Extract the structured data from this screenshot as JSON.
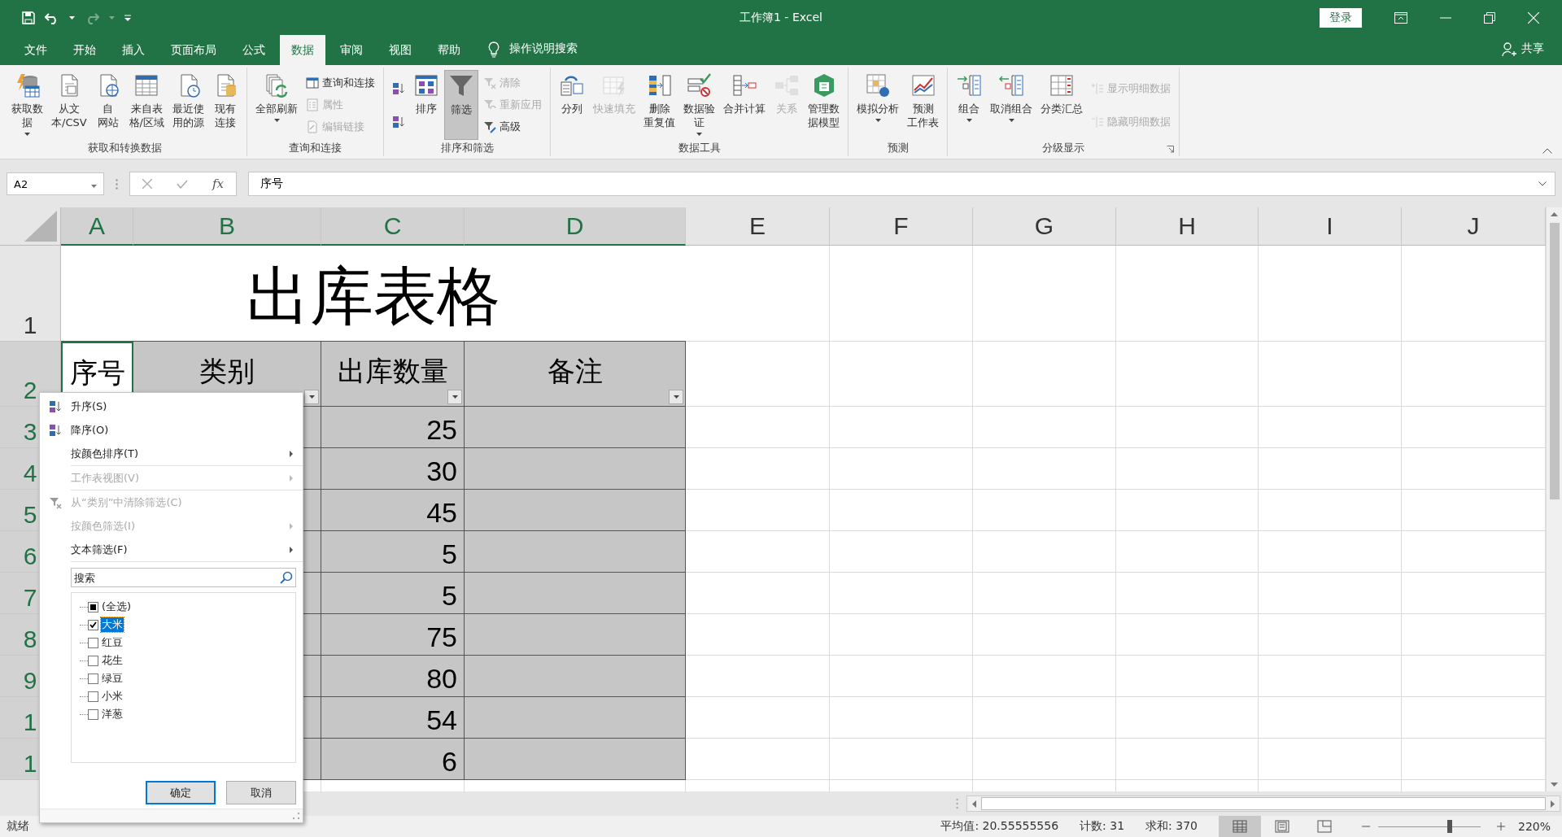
{
  "window": {
    "title": "工作簿1  -  Excel",
    "sign_in": "登录"
  },
  "quick_access": {
    "redo_enabled": false
  },
  "tabs": [
    {
      "label": "文件",
      "selected": false
    },
    {
      "label": "开始",
      "selected": false
    },
    {
      "label": "插入",
      "selected": false
    },
    {
      "label": "页面布局",
      "selected": false
    },
    {
      "label": "公式",
      "selected": false
    },
    {
      "label": "数据",
      "selected": true
    },
    {
      "label": "审阅",
      "selected": false
    },
    {
      "label": "视图",
      "selected": false
    },
    {
      "label": "帮助",
      "selected": false
    }
  ],
  "tell_me": "操作说明搜索",
  "share": "共享",
  "ribbon_groups": [
    {
      "label": "获取和转换数据",
      "launcher": false,
      "buttons": [
        {
          "lines": [
            "获取数",
            "据"
          ],
          "kind": "large",
          "disabled": false,
          "dropdown": true,
          "pressed": false
        },
        {
          "lines": [
            "从文",
            "本/CSV"
          ],
          "kind": "large",
          "disabled": false,
          "dropdown": false,
          "pressed": false
        },
        {
          "lines": [
            "自",
            "网站"
          ],
          "kind": "large",
          "disabled": false,
          "dropdown": false,
          "pressed": false
        },
        {
          "lines": [
            "来自表",
            "格/区域"
          ],
          "kind": "large",
          "disabled": false,
          "dropdown": false,
          "pressed": false
        },
        {
          "lines": [
            "最近使",
            "用的源"
          ],
          "kind": "large",
          "disabled": false,
          "dropdown": false,
          "pressed": false
        },
        {
          "lines": [
            "现有",
            "连接"
          ],
          "kind": "large",
          "disabled": false,
          "dropdown": false,
          "pressed": false
        }
      ]
    },
    {
      "label": "查询和连接",
      "launcher": false,
      "buttons": [
        {
          "lines": [
            "全部刷新"
          ],
          "kind": "large",
          "disabled": false,
          "dropdown": true,
          "pressed": false
        },
        {
          "lines": [
            "查询和连接"
          ],
          "kind": "small",
          "disabled": false,
          "dropdown": false,
          "pressed": false
        },
        {
          "lines": [
            "属性"
          ],
          "kind": "small",
          "disabled": true,
          "dropdown": false,
          "pressed": false
        },
        {
          "lines": [
            "编辑链接"
          ],
          "kind": "small",
          "disabled": true,
          "dropdown": false,
          "pressed": false
        }
      ]
    },
    {
      "label": "排序和筛选",
      "launcher": false,
      "buttons": [
        {
          "kind": "small",
          "disabled": false,
          "dropdown": false,
          "pressed": false
        },
        {
          "kind": "small",
          "disabled": false,
          "dropdown": false,
          "pressed": false
        },
        {
          "lines": [
            "排序"
          ],
          "kind": "large",
          "disabled": false,
          "dropdown": false,
          "pressed": false
        },
        {
          "lines": [
            "筛选"
          ],
          "kind": "large",
          "disabled": false,
          "dropdown": false,
          "pressed": true
        },
        {
          "lines": [
            "清除"
          ],
          "kind": "small",
          "disabled": true,
          "dropdown": false,
          "pressed": false
        },
        {
          "lines": [
            "重新应用"
          ],
          "kind": "small",
          "disabled": true,
          "dropdown": false,
          "pressed": false
        },
        {
          "lines": [
            "高级"
          ],
          "kind": "small",
          "disabled": false,
          "dropdown": false,
          "pressed": false
        }
      ]
    },
    {
      "label": "数据工具",
      "launcher": false,
      "buttons": [
        {
          "lines": [
            "分列"
          ],
          "kind": "large",
          "disabled": false,
          "dropdown": false,
          "pressed": false
        },
        {
          "lines": [
            "快速填充"
          ],
          "kind": "large",
          "disabled": true,
          "dropdown": false,
          "pressed": false
        },
        {
          "lines": [
            "删除",
            "重复值"
          ],
          "kind": "large",
          "disabled": false,
          "dropdown": false,
          "pressed": false
        },
        {
          "lines": [
            "数据验",
            "证"
          ],
          "kind": "large",
          "disabled": false,
          "dropdown": true,
          "pressed": false
        },
        {
          "lines": [
            "合并计算"
          ],
          "kind": "large",
          "disabled": false,
          "dropdown": false,
          "pressed": false
        },
        {
          "lines": [
            "关系"
          ],
          "kind": "large",
          "disabled": true,
          "dropdown": false,
          "pressed": false
        },
        {
          "lines": [
            "管理数",
            "据模型"
          ],
          "kind": "large",
          "disabled": false,
          "dropdown": false,
          "pressed": false
        }
      ]
    },
    {
      "label": "预测",
      "launcher": false,
      "buttons": [
        {
          "lines": [
            "模拟分析"
          ],
          "kind": "large",
          "disabled": false,
          "dropdown": true,
          "pressed": false
        },
        {
          "lines": [
            "预测",
            "工作表"
          ],
          "kind": "large",
          "disabled": false,
          "dropdown": false,
          "pressed": false
        }
      ]
    },
    {
      "label": "分级显示",
      "launcher": true,
      "buttons": [
        {
          "lines": [
            "组合"
          ],
          "kind": "large",
          "disabled": false,
          "dropdown": true,
          "pressed": false
        },
        {
          "lines": [
            "取消组合"
          ],
          "kind": "large",
          "disabled": false,
          "dropdown": true,
          "pressed": false
        },
        {
          "lines": [
            "分类汇总"
          ],
          "kind": "large",
          "disabled": false,
          "dropdown": false,
          "pressed": false
        },
        {
          "lines": [
            "显示明细数据"
          ],
          "kind": "small",
          "disabled": true,
          "dropdown": false,
          "pressed": false
        },
        {
          "lines": [
            "隐藏明细数据"
          ],
          "kind": "small",
          "disabled": true,
          "dropdown": false,
          "pressed": false
        }
      ]
    }
  ],
  "formula_bar": {
    "name_box": "A2",
    "function_label": "fx",
    "value": "序号"
  },
  "sheet": {
    "columns": [
      {
        "label": "A",
        "selected": true
      },
      {
        "label": "B",
        "selected": true
      },
      {
        "label": "C",
        "selected": true
      },
      {
        "label": "D",
        "selected": true
      },
      {
        "label": "E",
        "selected": false
      },
      {
        "label": "F",
        "selected": false
      },
      {
        "label": "G",
        "selected": false
      },
      {
        "label": "H",
        "selected": false
      },
      {
        "label": "I",
        "selected": false
      },
      {
        "label": "J",
        "selected": false
      }
    ],
    "title_row": {
      "header": "1",
      "selected": false,
      "text": "出库表格"
    },
    "header_row": {
      "header": "2",
      "selected": true,
      "cells": [
        {
          "text": "序号",
          "active": true,
          "filter": false
        },
        {
          "text": "类别",
          "active": false,
          "filter": true
        },
        {
          "text": "出库数量",
          "active": false,
          "filter": true
        },
        {
          "text": "备注",
          "active": false,
          "filter": true
        }
      ]
    },
    "data_rows": [
      {
        "header": "3",
        "selected": true,
        "quantity": "25"
      },
      {
        "header": "4",
        "selected": true,
        "quantity": "30"
      },
      {
        "header": "5",
        "selected": true,
        "quantity": "45"
      },
      {
        "header": "6",
        "selected": true,
        "quantity": "5"
      },
      {
        "header": "7",
        "selected": true,
        "quantity": "5"
      },
      {
        "header": "8",
        "selected": true,
        "quantity": "75"
      },
      {
        "header": "9",
        "selected": true,
        "quantity": "80"
      },
      {
        "header": "1",
        "selected": true,
        "quantity": "54"
      },
      {
        "header": "1",
        "selected": true,
        "quantity": "6"
      }
    ]
  },
  "filter_menu": {
    "sections": [
      [
        {
          "label": "升序(S)",
          "disabled": false,
          "submenu": false
        },
        {
          "label": "降序(O)",
          "disabled": false,
          "submenu": false
        },
        {
          "label": "按颜色排序(T)",
          "disabled": false,
          "submenu": true
        }
      ],
      [
        {
          "label": "工作表视图(V)",
          "disabled": true,
          "submenu": true
        }
      ],
      [
        {
          "label": "从“类别”中清除筛选(C)",
          "disabled": true,
          "submenu": false
        },
        {
          "label": "按颜色筛选(I)",
          "disabled": true,
          "submenu": true
        },
        {
          "label": "文本筛选(F)",
          "disabled": false,
          "submenu": true
        }
      ]
    ],
    "search": {
      "placeholder": "搜索"
    },
    "values": [
      {
        "label": "(全选)",
        "checked": false,
        "indeterminate": true,
        "selected": false
      },
      {
        "label": "大米",
        "checked": true,
        "indeterminate": false,
        "selected": true
      },
      {
        "label": "红豆",
        "checked": false,
        "indeterminate": false,
        "selected": false
      },
      {
        "label": "花生",
        "checked": false,
        "indeterminate": false,
        "selected": false
      },
      {
        "label": "绿豆",
        "checked": false,
        "indeterminate": false,
        "selected": false
      },
      {
        "label": "小米",
        "checked": false,
        "indeterminate": false,
        "selected": false
      },
      {
        "label": "洋葱",
        "checked": false,
        "indeterminate": false,
        "selected": false
      }
    ],
    "buttons": [
      {
        "label": "确定",
        "default": true
      },
      {
        "label": "取消",
        "default": false
      }
    ]
  },
  "status_bar": {
    "ready": "就绪",
    "average": "平均值: 20.55555556",
    "count": "计数: 31",
    "sum": "求和: 370",
    "views": [
      {
        "selected": true
      },
      {
        "selected": false
      },
      {
        "selected": false
      }
    ],
    "zoom": {
      "level": 0.7,
      "reading": "220%"
    }
  }
}
